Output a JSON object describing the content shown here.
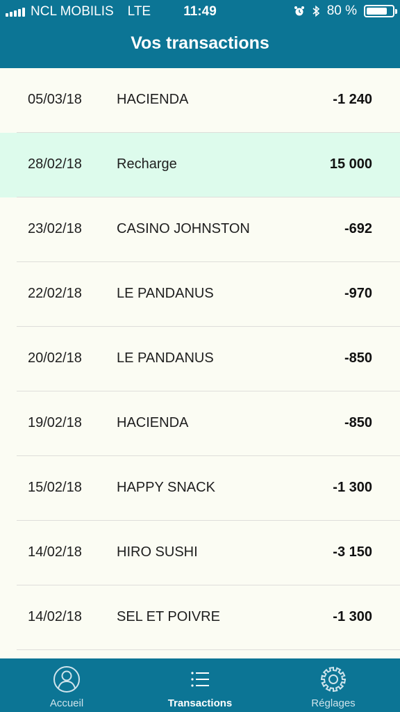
{
  "status_bar": {
    "carrier": "NCL MOBILIS",
    "network": "LTE",
    "time": "11:49",
    "battery_text": "80 %",
    "battery_level": 0.8
  },
  "header": {
    "title": "Vos transactions"
  },
  "transactions": [
    {
      "date": "05/03/18",
      "label": "HACIENDA",
      "amount": "-1 240"
    },
    {
      "date": "28/02/18",
      "label": "Recharge",
      "amount": "15 000",
      "highlight": true
    },
    {
      "date": "23/02/18",
      "label": "CASINO JOHNSTON",
      "amount": "-692"
    },
    {
      "date": "22/02/18",
      "label": "LE PANDANUS",
      "amount": "-970"
    },
    {
      "date": "20/02/18",
      "label": "LE PANDANUS",
      "amount": "-850"
    },
    {
      "date": "19/02/18",
      "label": "HACIENDA",
      "amount": "-850"
    },
    {
      "date": "15/02/18",
      "label": "HAPPY SNACK",
      "amount": "-1 300"
    },
    {
      "date": "14/02/18",
      "label": "HIRO SUSHI",
      "amount": "-3 150"
    },
    {
      "date": "14/02/18",
      "label": "SEL ET POIVRE",
      "amount": "-1 300"
    }
  ],
  "tab_bar": {
    "tabs": [
      {
        "label": "Accueil",
        "icon": "user-circle-icon"
      },
      {
        "label": "Transactions",
        "icon": "list-icon",
        "active": true
      },
      {
        "label": "Réglages",
        "icon": "gear-icon"
      }
    ]
  },
  "colors": {
    "brand": "#0c7595",
    "background": "#fbfcf3",
    "highlight_row": "#ddfbec"
  }
}
